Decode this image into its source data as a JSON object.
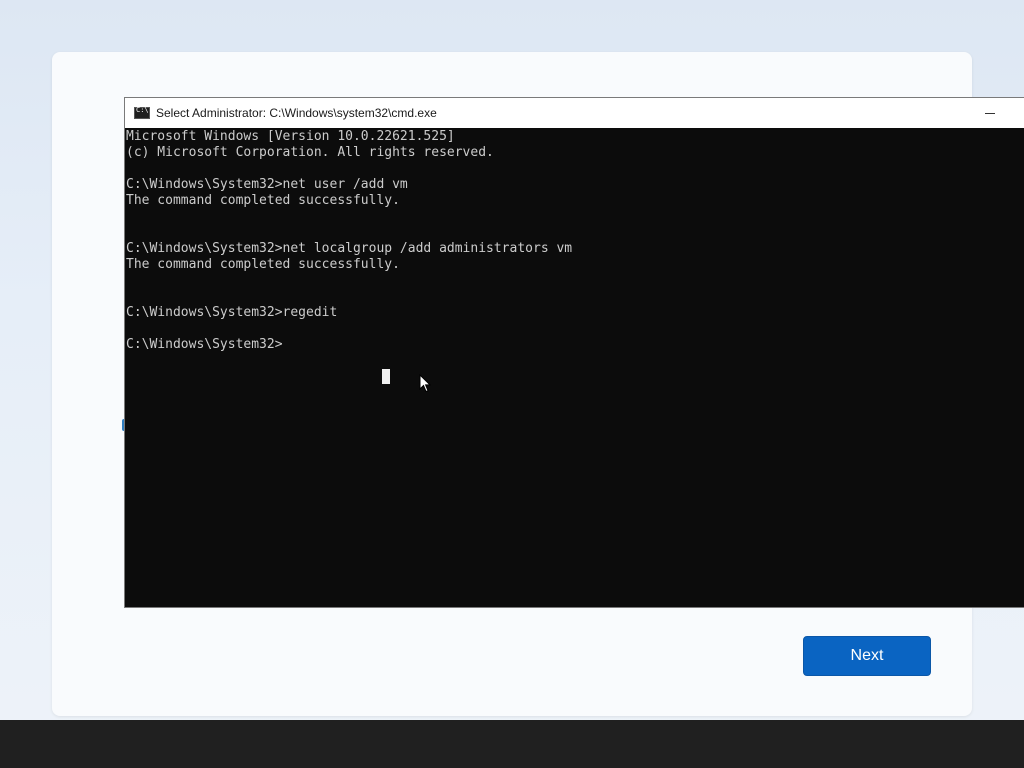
{
  "window": {
    "title": "Select Administrator: C:\\Windows\\system32\\cmd.exe",
    "icon": "cmd-app-icon"
  },
  "console": {
    "lines": [
      "Microsoft Windows [Version 10.0.22621.525]",
      "(c) Microsoft Corporation. All rights reserved.",
      "",
      "C:\\Windows\\System32>net user /add vm",
      "The command completed successfully.",
      "",
      "",
      "C:\\Windows\\System32>net localgroup /add administrators vm",
      "The command completed successfully.",
      "",
      "",
      "C:\\Windows\\System32>regedit",
      "",
      "C:\\Windows\\System32>"
    ]
  },
  "setup": {
    "next_label": "Next"
  },
  "colors": {
    "console_bg": "#0c0c0c",
    "console_text": "#cccccc",
    "accent": "#0a64c2"
  }
}
